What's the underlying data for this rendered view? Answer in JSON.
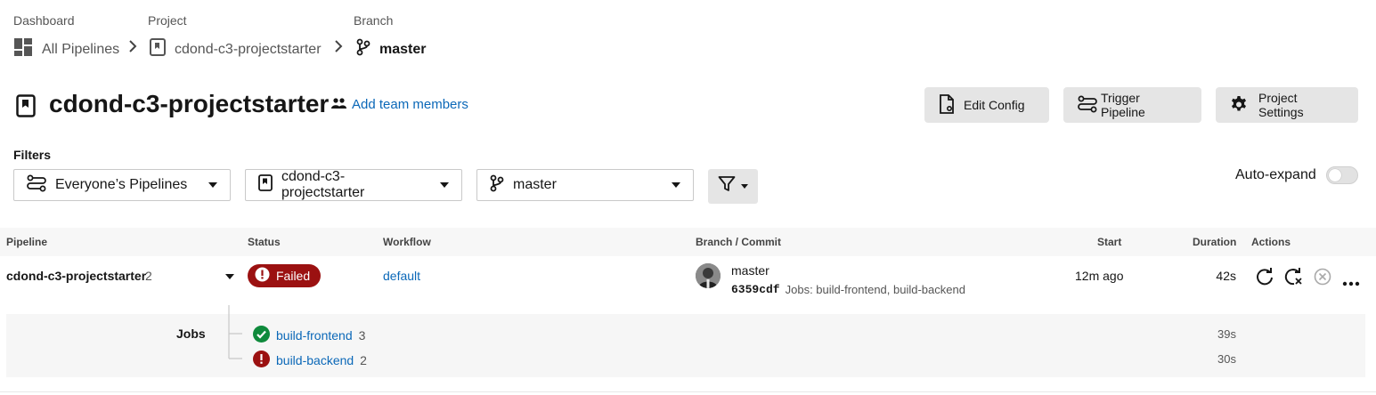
{
  "breadcrumbs": {
    "dashboard": {
      "label": "Dashboard",
      "value": "All Pipelines"
    },
    "project": {
      "label": "Project",
      "value": "cdond-c3-projectstarter"
    },
    "branch": {
      "label": "Branch",
      "value": "master"
    }
  },
  "header": {
    "title": "cdond-c3-projectstarter",
    "add_team_members": "Add team members",
    "buttons": {
      "edit_config": "Edit Config",
      "trigger_pipeline": "Trigger Pipeline",
      "project_settings": "Project Settings"
    }
  },
  "filters": {
    "label": "Filters",
    "pipelines": "Everyone’s Pipelines",
    "project": "cdond-c3-projectstarter",
    "branch": "master",
    "auto_expand_label": "Auto-expand",
    "auto_expand": false
  },
  "table": {
    "columns": {
      "pipeline": "Pipeline",
      "status": "Status",
      "workflow": "Workflow",
      "branch_commit": "Branch / Commit",
      "start": "Start",
      "duration": "Duration",
      "actions": "Actions"
    },
    "row": {
      "pipeline_name": "cdond-c3-projectstarter",
      "pipeline_number": "2",
      "status": "Failed",
      "workflow": "default",
      "branch": "master",
      "commit": "6359cdf",
      "commit_message": "Jobs: build-frontend, build-backend",
      "start": "12m ago",
      "duration": "42s"
    },
    "jobs": {
      "label": "Jobs",
      "items": [
        {
          "name": "build-frontend",
          "number": "3",
          "duration": "39s",
          "status": "success"
        },
        {
          "name": "build-backend",
          "number": "2",
          "duration": "30s",
          "status": "failed"
        }
      ]
    }
  },
  "colors": {
    "failed": "#9b1111",
    "success": "#0f8a3c",
    "link": "#0b68b8"
  },
  "icons": [
    "dashboard-icon",
    "project-icon",
    "branch-icon",
    "team-icon",
    "file-config-icon",
    "trigger-icon",
    "gear-icon",
    "filter-icon",
    "rerun-icon",
    "rerun-failed-icon",
    "cancel-icon",
    "more-icon"
  ]
}
